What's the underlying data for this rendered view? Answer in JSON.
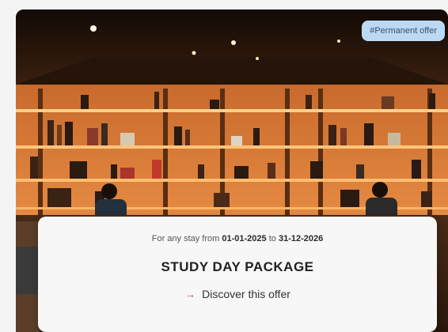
{
  "card": {
    "badge": "#Permanent offer",
    "stay_prefix": "For any stay from",
    "stay_start": "01-01-2025",
    "stay_mid": "to",
    "stay_end": "31-12-2026",
    "title": "STUDY DAY PACKAGE",
    "link_arrow": "→",
    "link_label": "Discover this offer"
  },
  "colors": {
    "badge_bg": "#bcd9f3",
    "accent_arrow": "#e04a3f",
    "shelf_light": "#f0a25a"
  },
  "icons": {
    "link": "arrow-right-icon"
  }
}
